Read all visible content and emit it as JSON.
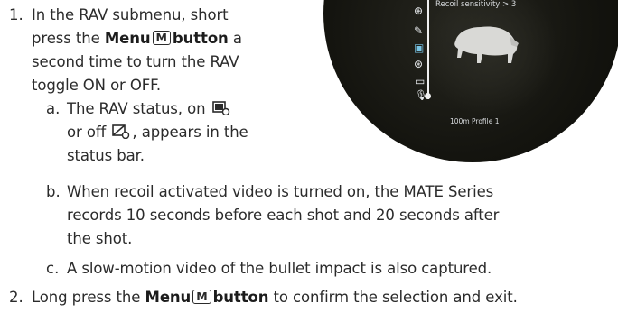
{
  "scope_display": {
    "menu_title": "Recoil sensitivity > 3",
    "bottom_status": "100m  Profile 1"
  },
  "steps": [
    {
      "number": "1.",
      "lines": [
        "In the RAV submenu, short",
        "press the",
        "Menu",
        "M",
        "button",
        "a",
        "second time to turn the RAV",
        "toggle ON or OFF."
      ]
    },
    {
      "number": "2.",
      "before": "Long press the",
      "bold1": "Menu",
      "key": "M",
      "bold2": "button",
      "after": "to confirm the selection and exit."
    }
  ],
  "substeps": {
    "a": {
      "label": "a.",
      "line1_before": "The RAV status, on",
      "line2_before": "or off",
      "line2_after": ", appears in the",
      "line3": "status bar."
    },
    "b": {
      "label": "b.",
      "line1": "When recoil activated video is turned on, the MATE Series",
      "line2": "records 10 seconds before each shot and 20 seconds after",
      "line3": "the shot."
    },
    "c": {
      "label": "c.",
      "line1": "A slow-motion video of the bullet impact is also captured."
    }
  }
}
